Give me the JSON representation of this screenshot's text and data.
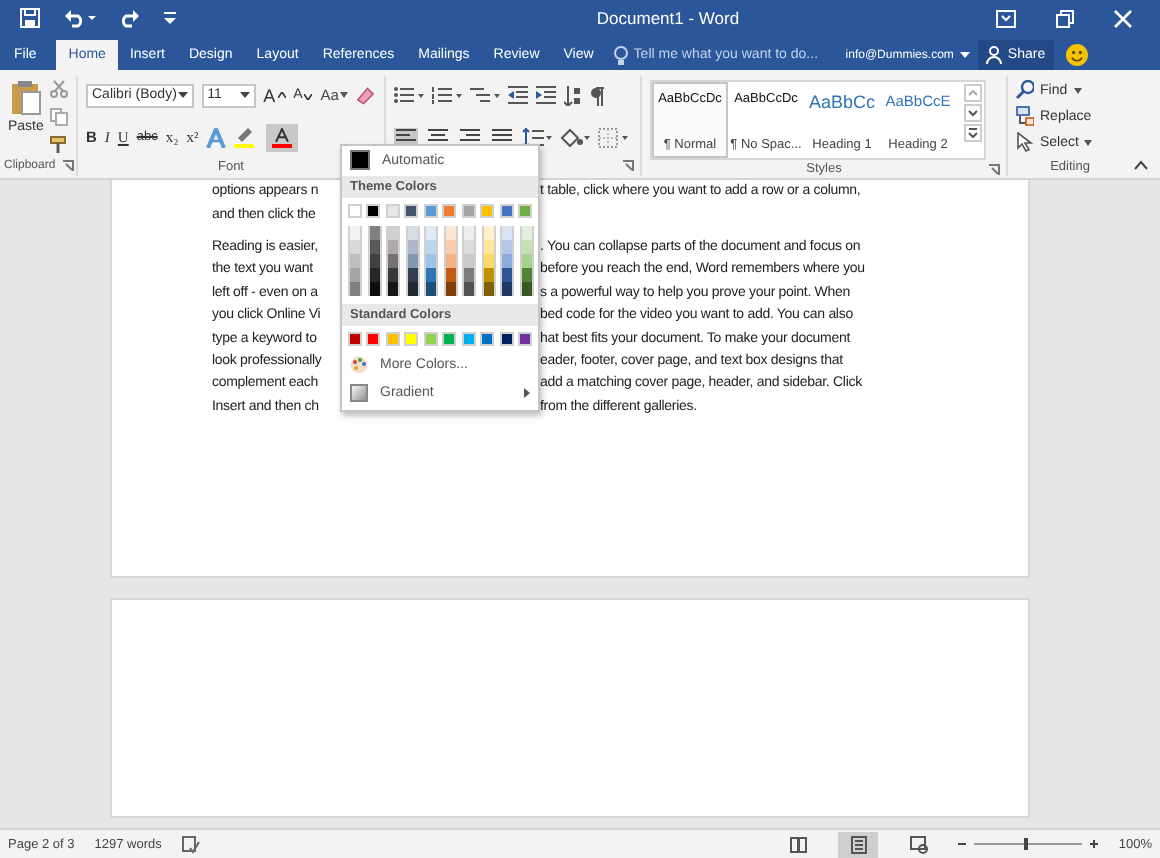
{
  "window": {
    "title": "Document1 - Word"
  },
  "tabs": [
    {
      "label": "File",
      "selected": false
    },
    {
      "label": "Home",
      "selected": true
    },
    {
      "label": "Insert",
      "selected": false
    },
    {
      "label": "Design",
      "selected": false
    },
    {
      "label": "Layout",
      "selected": false
    },
    {
      "label": "References",
      "selected": false
    },
    {
      "label": "Mailings",
      "selected": false
    },
    {
      "label": "Review",
      "selected": false
    },
    {
      "label": "View",
      "selected": false
    }
  ],
  "tell_me": {
    "placeholder": "Tell me what you want to do..."
  },
  "account": "info@Dummies.com",
  "share": "Share",
  "ribbon": {
    "clipboard": {
      "label": "Clipboard",
      "paste": "Paste"
    },
    "font": {
      "label": "Font",
      "font_name": "Calibri (Body)",
      "font_size": "11",
      "grow": "A",
      "shrink": "A",
      "change_case": "Aa",
      "format_buttons": [
        {
          "label": "B",
          "kind": "bold"
        },
        {
          "label": "I",
          "kind": "italic"
        },
        {
          "label": "U",
          "kind": "underline"
        },
        {
          "label": "abc",
          "kind": "strike"
        },
        {
          "label": "x₂",
          "kind": "sub"
        },
        {
          "label": "x²",
          "kind": "sup"
        }
      ],
      "font_color_open": true
    },
    "styles": {
      "label": "Styles",
      "items": [
        {
          "preview": "AaBbCcDc",
          "name": "¶ Normal",
          "kind": "normal",
          "selected": true
        },
        {
          "preview": "AaBbCcDc",
          "name": "¶ No Spac...",
          "kind": "plain",
          "selected": false
        },
        {
          "preview": "AaBbCc",
          "name": "Heading 1",
          "kind": "heading1",
          "selected": false
        },
        {
          "preview": "AaBbCcE",
          "name": "Heading 2",
          "kind": "heading2",
          "selected": false
        }
      ]
    },
    "editing": {
      "label": "Editing",
      "items": [
        {
          "label": "Find",
          "kind": "find"
        },
        {
          "label": "Replace",
          "kind": "replace"
        },
        {
          "label": "Select",
          "kind": "select"
        }
      ]
    }
  },
  "document": {
    "paragraphs": [
      {
        "lines": [
          {
            "left": "options appears n",
            "right": "t table, click where you want to add a row or a column,"
          },
          {
            "left": "and then click the"
          }
        ]
      },
      {
        "lines": [
          {
            "left": "Reading is easier,",
            "right": ". You can collapse parts of the document and focus on"
          },
          {
            "left": "the text you want",
            "right": "before you reach the end, Word remembers where you"
          },
          {
            "left": "left off - even on a",
            "right": "s a powerful way to help you prove your point. When"
          },
          {
            "left": "you click Online Vi",
            "right": "bed code for the video you want to add. You can also"
          },
          {
            "left": "type a keyword to",
            "right": "hat best fits your document. To make your document"
          },
          {
            "left": "look professionally",
            "right": "eader, footer, cover page, and text box designs that"
          },
          {
            "left": "complement each",
            "right": "add a matching cover page, header, and sidebar. Click"
          },
          {
            "left": "Insert and then ch",
            "right": "from the different galleries."
          }
        ]
      }
    ]
  },
  "font_color_menu": {
    "automatic": "Automatic",
    "theme_header": "Theme Colors",
    "theme": [
      {
        "color": "#ffffff",
        "shades": [
          {
            "color": "#f2f2f2"
          },
          {
            "color": "#d9d9d9"
          },
          {
            "color": "#bfbfbf"
          },
          {
            "color": "#a6a6a6"
          },
          {
            "color": "#808080"
          }
        ]
      },
      {
        "color": "#000000",
        "shades": [
          {
            "color": "#808080"
          },
          {
            "color": "#595959"
          },
          {
            "color": "#404040"
          },
          {
            "color": "#262626"
          },
          {
            "color": "#0d0d0d"
          }
        ]
      },
      {
        "color": "#e7e6e6",
        "shades": [
          {
            "color": "#d0cece"
          },
          {
            "color": "#aeaaaa"
          },
          {
            "color": "#757171"
          },
          {
            "color": "#3a3838"
          },
          {
            "color": "#161616"
          }
        ]
      },
      {
        "color": "#44546a",
        "shades": [
          {
            "color": "#d6dce4"
          },
          {
            "color": "#adb9ca"
          },
          {
            "color": "#8497b0"
          },
          {
            "color": "#333f4f"
          },
          {
            "color": "#222a35"
          }
        ]
      },
      {
        "color": "#5b9bd5",
        "shades": [
          {
            "color": "#deebf6"
          },
          {
            "color": "#bdd7ee"
          },
          {
            "color": "#9dc3e6"
          },
          {
            "color": "#2e75b5"
          },
          {
            "color": "#1f4e79"
          }
        ]
      },
      {
        "color": "#ed7d31",
        "shades": [
          {
            "color": "#fbe5d5"
          },
          {
            "color": "#f7cbac"
          },
          {
            "color": "#f4b183"
          },
          {
            "color": "#c55a11"
          },
          {
            "color": "#843c0b"
          }
        ]
      },
      {
        "color": "#a5a5a5",
        "shades": [
          {
            "color": "#ededed"
          },
          {
            "color": "#dbdbdb"
          },
          {
            "color": "#c9c9c9"
          },
          {
            "color": "#7b7b7b"
          },
          {
            "color": "#525252"
          }
        ]
      },
      {
        "color": "#ffc000",
        "shades": [
          {
            "color": "#fff2cc"
          },
          {
            "color": "#ffe699"
          },
          {
            "color": "#ffd966"
          },
          {
            "color": "#bf9000"
          },
          {
            "color": "#7f6000"
          }
        ]
      },
      {
        "color": "#4472c4",
        "shades": [
          {
            "color": "#dae3f3"
          },
          {
            "color": "#b4c7e7"
          },
          {
            "color": "#8faadc"
          },
          {
            "color": "#2f5597"
          },
          {
            "color": "#203864"
          }
        ]
      },
      {
        "color": "#70ad47",
        "shades": [
          {
            "color": "#e2f0d9"
          },
          {
            "color": "#c5e0b4"
          },
          {
            "color": "#a9d18e"
          },
          {
            "color": "#538135"
          },
          {
            "color": "#385723"
          }
        ]
      }
    ],
    "standard_header": "Standard Colors",
    "standard": [
      {
        "color": "#c00000"
      },
      {
        "color": "#ff0000"
      },
      {
        "color": "#ffc000"
      },
      {
        "color": "#ffff00"
      },
      {
        "color": "#92d050"
      },
      {
        "color": "#00b050"
      },
      {
        "color": "#00b0f0"
      },
      {
        "color": "#0070c0"
      },
      {
        "color": "#002060"
      },
      {
        "color": "#7030a0"
      }
    ],
    "more": "More Colors...",
    "gradient": "Gradient"
  },
  "status_bar": {
    "page": "Page 2 of 3",
    "words": "1297 words",
    "views": [
      {
        "kind": "read",
        "selected": false
      },
      {
        "kind": "print",
        "selected": true
      },
      {
        "kind": "web",
        "selected": false
      }
    ],
    "zoom": "100%"
  }
}
